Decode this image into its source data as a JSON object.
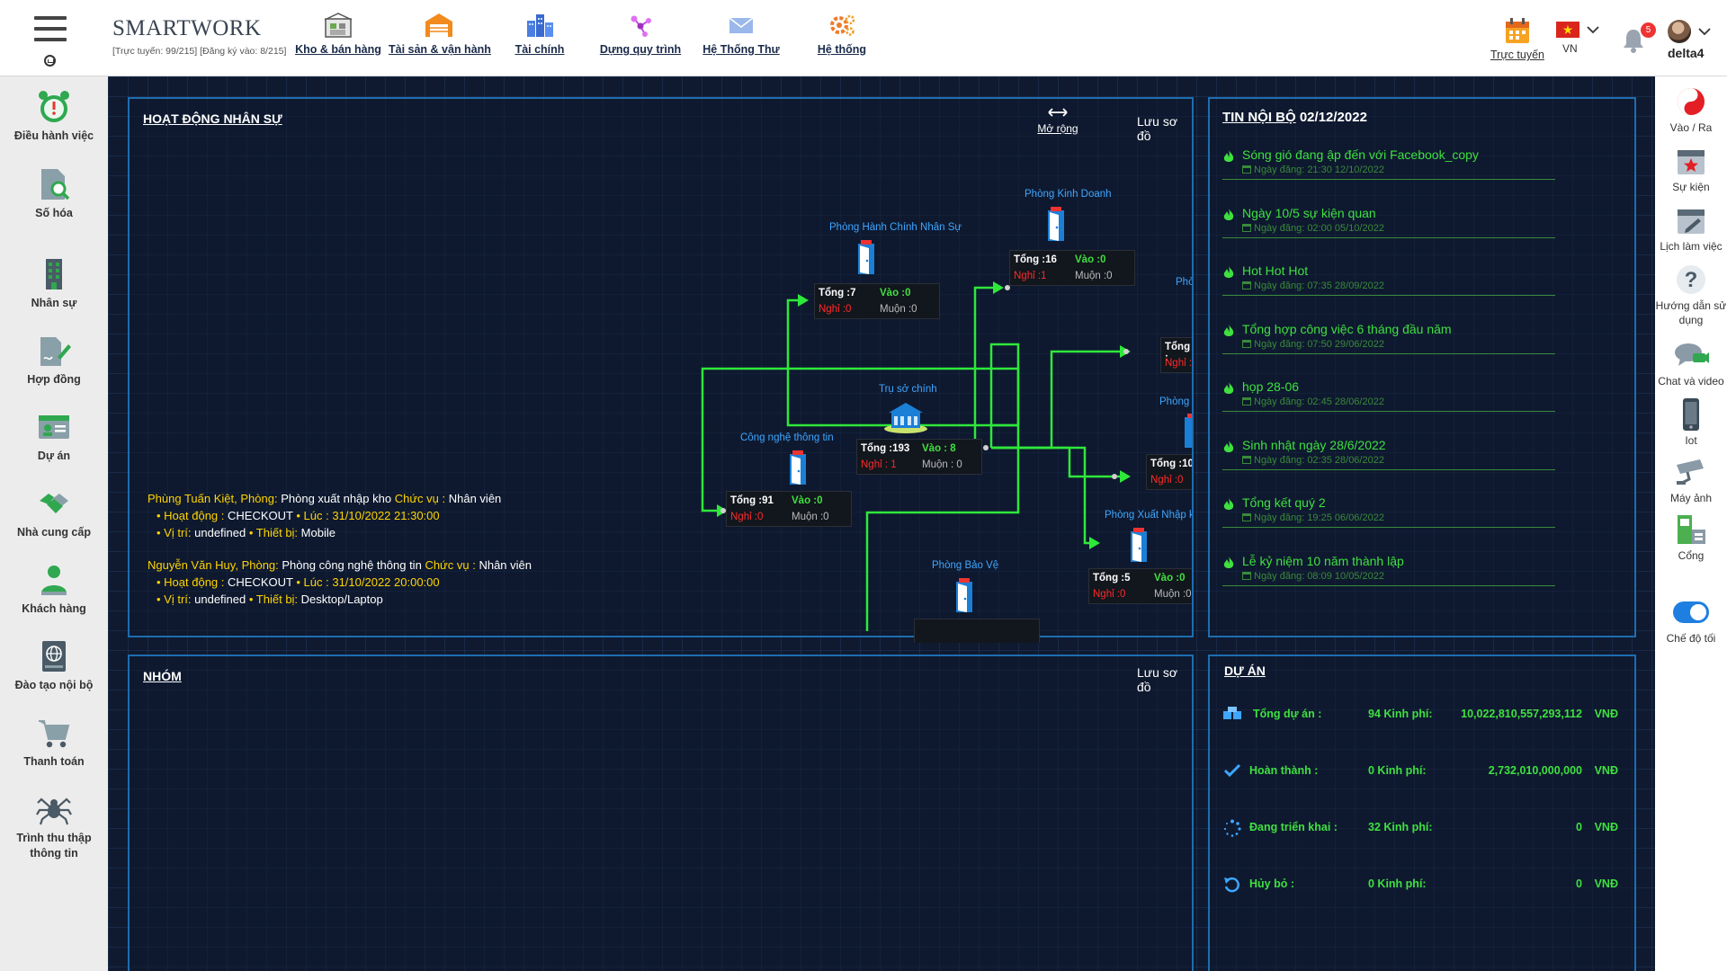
{
  "brand": {
    "name": "SMARTWORK",
    "online_info": "[Trực tuyến: 99/215] [Đăng ký vào: 8/215]"
  },
  "topnav": [
    {
      "label": "Kho & bán hàng",
      "icon": "warehouse-icon"
    },
    {
      "label": "Tài sản & vận hành",
      "icon": "garage-icon"
    },
    {
      "label": "Tài chính",
      "icon": "city-icon"
    },
    {
      "label": "Dựng quy trình",
      "icon": "workflow-icon"
    },
    {
      "label": "Hệ Thống Thư",
      "icon": "mail-icon"
    },
    {
      "label": "Hệ thống",
      "icon": "gear-icon"
    }
  ],
  "topright": {
    "online_label": "Trực tuyến",
    "lang_label": "VN",
    "notifications": "5",
    "username": "delta4"
  },
  "sidebar_left": [
    {
      "label": "Điều hành việc",
      "icon": "alarm-clock-icon"
    },
    {
      "label": "Số hóa",
      "icon": "document-search-icon"
    },
    {
      "label": "Nhân sự",
      "icon": "building-icon"
    },
    {
      "label": "Hợp đồng",
      "icon": "contract-sign-icon"
    },
    {
      "label": "Dự án",
      "icon": "id-card-icon"
    },
    {
      "label": "Nhà cung cấp",
      "icon": "handshake-icon"
    },
    {
      "label": "Khách hàng",
      "icon": "customer-icon"
    },
    {
      "label": "Đào tạo nội bộ",
      "icon": "globe-book-icon"
    },
    {
      "label": "Thanh toán",
      "icon": "cart-icon"
    },
    {
      "label": "Trình thu thập thông tin",
      "icon": "spider-icon"
    }
  ],
  "sidebar_right": [
    {
      "label": "Vào / Ra",
      "icon": "yin-yang-icon"
    },
    {
      "label": "Sự kiện",
      "icon": "calendar-star-icon"
    },
    {
      "label": "Lịch làm việc",
      "icon": "calendar-edit-icon"
    },
    {
      "label": "Hướng dẫn sử dụng",
      "icon": "question-icon"
    },
    {
      "label": "Chat và video",
      "icon": "chat-icon"
    },
    {
      "label": "Iot",
      "icon": "phone-icon"
    },
    {
      "label": "Máy ảnh",
      "icon": "cctv-icon"
    },
    {
      "label": "Cổng",
      "icon": "gate-icon"
    },
    {
      "label": "Chế độ tối",
      "icon": "toggle-icon"
    }
  ],
  "hr_panel": {
    "title": "HOẠT ĐỘNG NHÂN SỰ",
    "expand_label": "Mở rộng",
    "save_label": "Lưu sơ đồ",
    "nodes": [
      {
        "name": "Phòng Hành Chính Nhân Sự",
        "total": "Tổng :7",
        "in": "Vào :0",
        "off": "Nghỉ :0",
        "late": "Muộn :0"
      },
      {
        "name": "Phòng Kinh Doanh",
        "total": "Tổng :16",
        "in": "Vào :0",
        "off": "Nghỉ :1",
        "late": "Muộn :0"
      },
      {
        "name": "Trụ sở chính",
        "total": "Tổng :193",
        "in": "Vào : 8",
        "off": "Nghỉ : 1",
        "late": "Muộn : 0"
      },
      {
        "name": "Công nghệ thông tin",
        "total": "Tổng :91",
        "in": "Vào :0",
        "off": "Nghỉ :0",
        "late": "Muộn :0"
      },
      {
        "name": "Phòng Xuất Nhập k",
        "total": "Tổng :5",
        "in": "Vào :0",
        "off": "Nghỉ :0",
        "late": "Muộn :0"
      },
      {
        "name": "Phòng Bảo Vệ"
      }
    ],
    "partial_nodes": {
      "top_label": "Phò",
      "mid_label": "Phòng",
      "box1_total": "Tổng :",
      "box1_off": "Nghỉ :",
      "box2_total": "Tổng :10",
      "box2_off": "Nghỉ :0"
    },
    "logs": [
      {
        "name": "Phùng Tuấn Kiệt,",
        "room_label": "Phòng:",
        "room": "Phòng xuất nhập kho",
        "pos_label": "Chức vụ :",
        "pos": "Nhân viên",
        "act_label": "• Hoạt động :",
        "act": "CHECKOUT",
        "time_label": "• Lúc :",
        "time": "31/10/2022 21:30:00",
        "loc_label": "• Vị trí:",
        "loc": "undefined",
        "dev_label": "• Thiết bị:",
        "dev": "Mobile"
      },
      {
        "name": "Nguyễn Văn Huy,",
        "room_label": "Phòng:",
        "room": "Phòng công nghệ thông tin",
        "pos_label": "Chức vụ :",
        "pos": "Nhân viên",
        "act_label": "• Hoạt động :",
        "act": "CHECKOUT",
        "time_label": "• Lúc :",
        "time": "31/10/2022 20:00:00",
        "loc_label": "• Vị trí:",
        "loc": "undefined",
        "dev_label": "• Thiết bị:",
        "dev": "Desktop/Laptop"
      }
    ]
  },
  "news_panel": {
    "title": "TIN NỘI BỘ",
    "date": "02/12/2022",
    "items": [
      {
        "title": "Sóng gió đang ập đến với Facebook_copy",
        "date": "Ngày đăng: 21:30 12/10/2022"
      },
      {
        "title": "Ngày 10/5 sự kiện quan",
        "date": "Ngày đăng: 02:00 05/10/2022"
      },
      {
        "title": "Hot Hot Hot",
        "date": "Ngày đăng: 07:35 28/09/2022"
      },
      {
        "title": "Tổng hợp công việc 6 tháng đầu năm",
        "date": "Ngày đăng: 07:50 29/06/2022"
      },
      {
        "title": "họp 28-06",
        "date": "Ngày đăng: 02:45 28/06/2022"
      },
      {
        "title": "Sinh nhật ngày 28/6/2022",
        "date": "Ngày đăng: 02:35 28/06/2022"
      },
      {
        "title": "Tổng kết quý 2",
        "date": "Ngày đăng: 19:25 06/06/2022"
      },
      {
        "title": "Lễ kỷ niệm 10 năm thành lập",
        "date": "Ngày đăng: 08:09 10/05/2022"
      }
    ]
  },
  "group_panel": {
    "title": "NHÓM",
    "save_label": "Lưu sơ đồ"
  },
  "project_panel": {
    "title": "DỰ ÁN",
    "rows": [
      {
        "label": "Tổng dự án :",
        "count": "94 Kinh phí:",
        "amount": "10,022,810,557,293,112",
        "currency": "VNĐ",
        "icon": "boxes-icon"
      },
      {
        "label": "Hoàn thành :",
        "count": "0 Kinh phí:",
        "amount": "2,732,010,000,000",
        "currency": "VNĐ",
        "icon": "check-icon"
      },
      {
        "label": "Đang triển khai :",
        "count": "32 Kinh phí:",
        "amount": "0",
        "currency": "VNĐ",
        "icon": "spinner-icon"
      },
      {
        "label": "Hủy bỏ :",
        "count": "0 Kinh phí:",
        "amount": "0",
        "currency": "VNĐ",
        "icon": "undo-icon"
      }
    ]
  },
  "colors": {
    "accent_green": "#3fe03f",
    "accent_blue": "#3ea6ff",
    "panel_border": "#1e6db0",
    "alert_red": "#ff2a2a",
    "highlight_yellow": "#ffd400"
  }
}
